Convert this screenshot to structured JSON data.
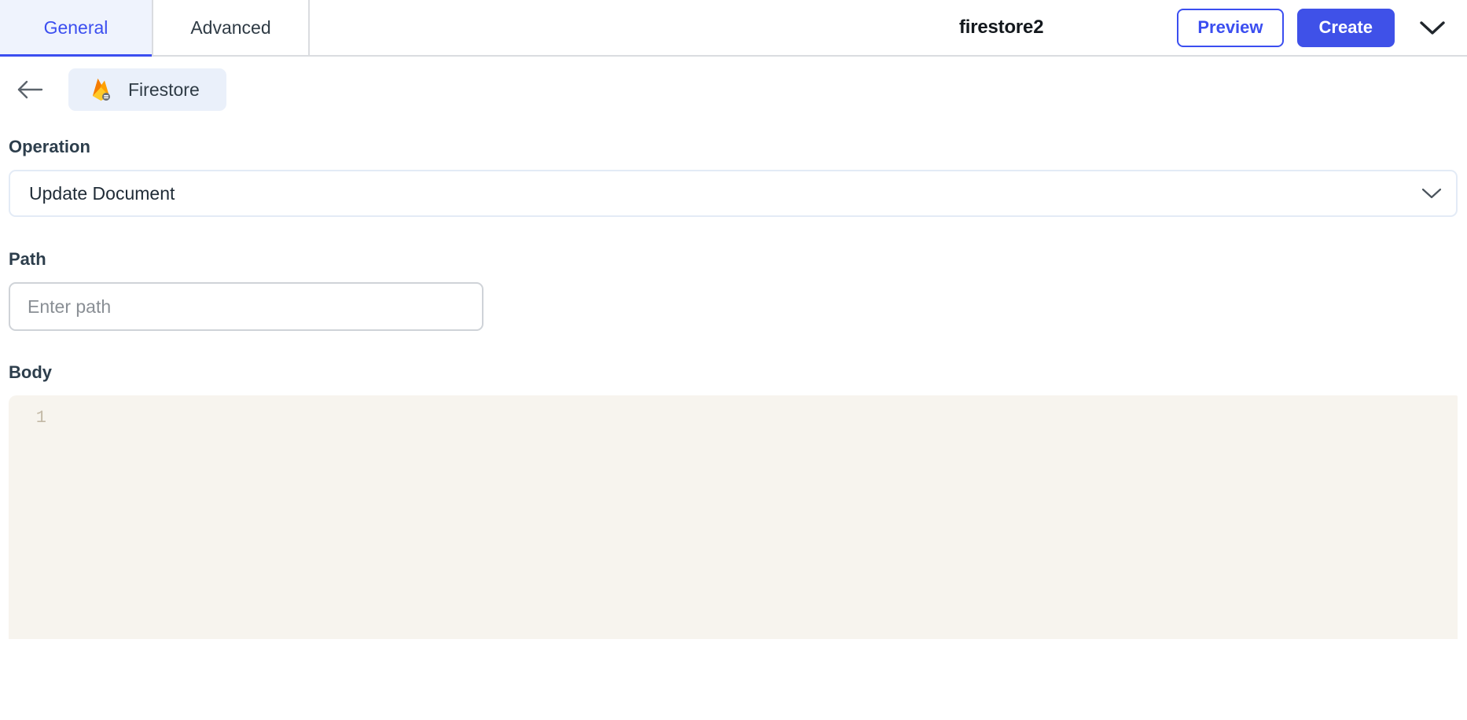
{
  "header": {
    "tabs": [
      {
        "label": "General",
        "active": true
      },
      {
        "label": "Advanced",
        "active": false
      }
    ],
    "title": "firestore2",
    "preview_label": "Preview",
    "create_label": "Create",
    "accent_color": "#3b4ef0",
    "create_bg": "#3f51e8",
    "icons": {
      "expand": "chevron-down-icon"
    }
  },
  "breadcrumb": {
    "back_icon": "arrow-left-icon",
    "app_icon": "firebase-firestore-icon",
    "app_label": "Firestore"
  },
  "form": {
    "operation": {
      "label": "Operation",
      "value": "Update Document",
      "chevron_icon": "chevron-down-icon"
    },
    "path": {
      "label": "Path",
      "value": "",
      "placeholder": "Enter path"
    },
    "body": {
      "label": "Body",
      "line_numbers": [
        "1"
      ],
      "code": ""
    }
  },
  "colors": {
    "editor_background": "#f7f4ee",
    "gutter_text": "#c3b9a6",
    "tab_active_bg": "#eff3fd",
    "chip_bg": "#eaf0fa",
    "border": "#dadce0"
  }
}
